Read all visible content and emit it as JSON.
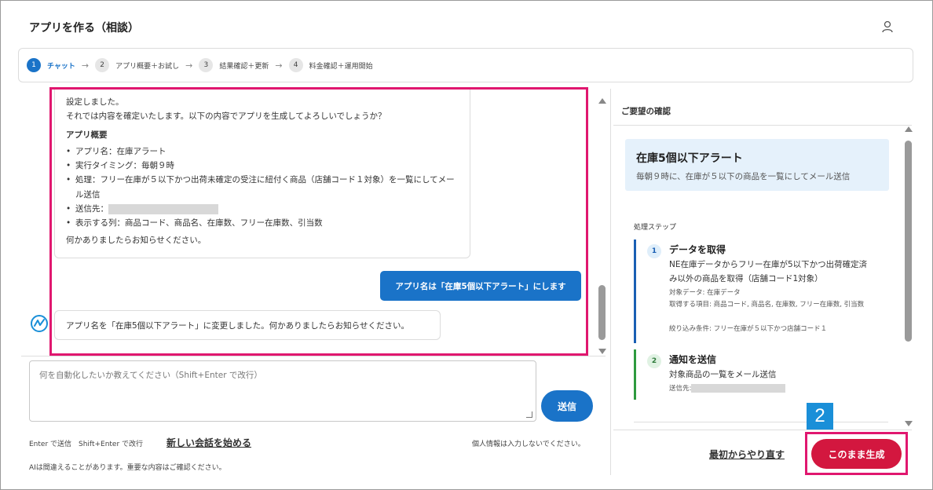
{
  "header": {
    "title": "アプリを作る（相談）"
  },
  "stepper": {
    "steps": [
      {
        "num": "1",
        "label": "チャット"
      },
      {
        "num": "2",
        "label": "アプリ概要＋お試し"
      },
      {
        "num": "3",
        "label": "結果確認＋更新"
      },
      {
        "num": "4",
        "label": "料金確認＋運用開始"
      }
    ],
    "arrow": "→"
  },
  "chat": {
    "bot_message": {
      "line1": "設定しました。",
      "line2": "それでは内容を確定いたします。以下の内容でアプリを生成してよろしいでしょうか？",
      "heading": "アプリ概要",
      "items": [
        "アプリ名：在庫アラート",
        "実行タイミング：毎朝９時",
        "処理：フリー在庫が５以下かつ出荷未確定の受注に紐付く商品（店舗コード１対象）を一覧にしてメール送信",
        "送信先：",
        "表示する列：商品コード、商品名、在庫数、フリー在庫数、引当数"
      ],
      "footer": "何かありましたらお知らせください。"
    },
    "user_message": "アプリ名は「在庫5個以下アラート」にします",
    "bot_reply": "アプリ名を「在庫5個以下アラート」に変更しました。何かありましたらお知らせください。"
  },
  "composer": {
    "placeholder": "何を自動化したいか教えてください（Shift+Enter で改行）",
    "send_label": "送信",
    "hint_left": "Enter で送信　Shift+Enter で改行",
    "new_chat_label": "新しい会話を始める",
    "hint_right": "個人情報は入力しないでください。",
    "ai_note": "AIは間違えることがあります。重要な内容はご確認ください。"
  },
  "confirm_panel": {
    "title": "ご要望の確認",
    "summary_title": "在庫5個以下アラート",
    "summary_desc": "毎朝９時に、在庫が５以下の商品を一覧にしてメール送信",
    "steps_label": "処理ステップ",
    "steps": [
      {
        "num": "1",
        "title": "データを取得",
        "desc": "NE在庫データからフリー在庫が5以下かつ出荷確定済み以外の商品を取得（店舗コード1対象）",
        "meta1": "対象データ: 在庫データ",
        "meta2": "取得する項目: 商品コード, 商品名, 在庫数, フリー在庫数, 引当数",
        "meta3": "絞り込み条件: フリー在庫が５以下かつ店舗コード１"
      },
      {
        "num": "2",
        "title": "通知を送信",
        "desc": "対象商品の一覧をメール送信",
        "meta1": "送信先:"
      }
    ],
    "restart_label": "最初からやり直す",
    "generate_label": "このまま生成"
  },
  "callout": {
    "number": "2"
  },
  "colors": {
    "primary": "#1a73c8",
    "accent": "#d3173f",
    "highlight": "#e0176f",
    "callout": "#1a8fd8"
  }
}
